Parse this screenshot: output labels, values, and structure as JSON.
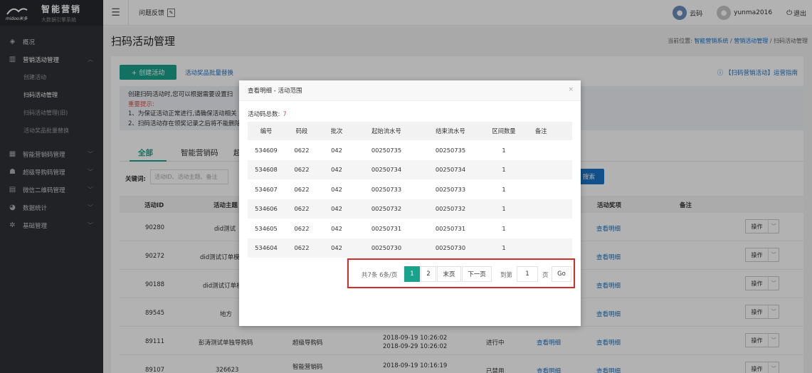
{
  "app": {
    "name": "智能营销",
    "tagline": "大数据引擎系统",
    "logo_sub": "midoo米多"
  },
  "sidebar": {
    "items": [
      {
        "label": "概况",
        "icon": "layers-icon"
      },
      {
        "label": "营销活动管理",
        "icon": "activity-icon",
        "sub": [
          {
            "label": "创建活动"
          },
          {
            "label": "扫码活动管理"
          },
          {
            "label": "扫码活动管理(旧)"
          },
          {
            "label": "活动奖品批量替换"
          }
        ]
      },
      {
        "label": "智能营销码管理",
        "icon": "qrcode-icon"
      },
      {
        "label": "超级导购码管理",
        "icon": "user-group-icon"
      },
      {
        "label": "微信二维码管理",
        "icon": "barcode-icon"
      },
      {
        "label": "数据统计",
        "icon": "pie-chart-icon"
      },
      {
        "label": "基础管理",
        "icon": "gear-icon"
      }
    ]
  },
  "topbar": {
    "feedback": "问题反馈",
    "cloud_user": "云码",
    "username": "yunma2016",
    "logout": "退出"
  },
  "page": {
    "title": "扫码活动管理",
    "crumb_prefix": "当前位置:",
    "crumbs": [
      "智能营销系统",
      "营销活动管理",
      "扫码活动管理"
    ],
    "create_btn": "+ 创建活动",
    "batch_link": "活动奖品批量替换",
    "guide": "【扫码营销活动】运营指南",
    "notice": {
      "line1": "创建扫码活动时,您可以根据需要设置扫",
      "heading": "重要提示:",
      "line2": "1、为保证活动正常进行,请确保活动相关",
      "line3": "2、扫码活动存在领奖记录之后将不能删除"
    },
    "tabs": [
      "全部",
      "智能营销码",
      "超"
    ],
    "keyword_label": "关键词:",
    "keyword_placeholder": "活动ID、活动主题、备注",
    "search_btn": "搜索",
    "list_headers": [
      "活动ID",
      "活动主题",
      "活动奖项",
      "备注"
    ],
    "rows": [
      {
        "id": "90280",
        "theme": "did测试",
        "type": "",
        "time1": "",
        "time2": "",
        "status": "",
        "detail": "",
        "prize": "查看明细",
        "op": "操作"
      },
      {
        "id": "90272",
        "theme": "did测试订单模",
        "type": "",
        "time1": "",
        "time2": "",
        "status": "",
        "detail": "",
        "prize": "查看明细",
        "op": "操作"
      },
      {
        "id": "90188",
        "theme": "did测试订单模",
        "type": "",
        "time1": "",
        "time2": "",
        "status": "",
        "detail": "",
        "prize": "查看明细",
        "op": "操作"
      },
      {
        "id": "89545",
        "theme": "地方",
        "type": "",
        "time1": "",
        "time2": "",
        "status": "",
        "detail": "",
        "prize": "查看明细",
        "op": "操作"
      },
      {
        "id": "89111",
        "theme": "彭涛测试单独导购码",
        "type": "超级导购码",
        "time1": "2018-09-19 10:26:02",
        "time2": "2018-09-29 10:26:02",
        "status": "进行中",
        "detail": "查看明细",
        "prize": "查看明细",
        "op": "操作"
      },
      {
        "id": "89107",
        "theme": "326623",
        "type": "智能营销码",
        "time1": "2018-09-19 10:16:19",
        "time2": "",
        "status": "已禁用",
        "detail": "查看明细",
        "prize": "查看明细",
        "op": "操作"
      }
    ]
  },
  "modal": {
    "title": "查看明细 - 活动范围",
    "close": "×",
    "total_label": "活动码总数:",
    "total_value": "7",
    "headers": [
      "编号",
      "码段",
      "批次",
      "起始流水号",
      "结束流水号",
      "区间数量",
      "备注"
    ],
    "rows": [
      [
        "534609",
        "0622",
        "042",
        "00250735",
        "00250735",
        "1",
        ""
      ],
      [
        "534608",
        "0622",
        "042",
        "00250734",
        "00250734",
        "1",
        ""
      ],
      [
        "534607",
        "0622",
        "042",
        "00250733",
        "00250733",
        "1",
        ""
      ],
      [
        "534606",
        "0622",
        "042",
        "00250732",
        "00250732",
        "1",
        ""
      ],
      [
        "534605",
        "0622",
        "042",
        "00250731",
        "00250731",
        "1",
        ""
      ],
      [
        "534604",
        "0622",
        "042",
        "00250730",
        "00250730",
        "1",
        ""
      ]
    ],
    "pager": {
      "summary": "共7条  6条/页",
      "pages": [
        "1",
        "2"
      ],
      "current": "1",
      "last": "末页",
      "next": "下一页",
      "goto_label": "到第",
      "goto_value": "1",
      "page_unit": "页",
      "go": "Go"
    }
  },
  "colors": {
    "accent": "#1aa38c",
    "link": "#1a73c7",
    "sidebar": "#2f3136",
    "highlight": "#d62b2b"
  }
}
